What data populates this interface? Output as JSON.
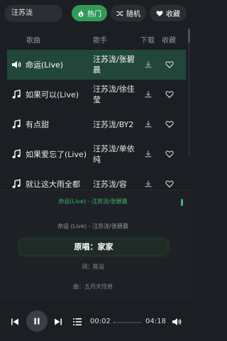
{
  "search": {
    "value": "汪苏泷"
  },
  "filters": [
    {
      "label": "热门",
      "icon": "fire-icon",
      "active": true
    },
    {
      "label": "随机",
      "icon": "shuffle-icon",
      "active": false
    },
    {
      "label": "收藏",
      "icon": "heart-icon",
      "active": false
    }
  ],
  "table": {
    "headers": {
      "song": "歌曲",
      "artist": "歌手",
      "download": "下载",
      "favorite": "收藏"
    },
    "rows": [
      {
        "title": "命运(Live)",
        "artist": "汪苏泷/张碧晨",
        "playing": true
      },
      {
        "title": "如果可以(Live)",
        "artist": "汪苏泷/徐佳莹",
        "playing": false
      },
      {
        "title": "有点甜",
        "artist": "汪苏泷/BY2",
        "playing": false
      },
      {
        "title": "如果爱忘了(Live)",
        "artist": "汪苏泷/单依纯",
        "playing": false
      },
      {
        "title": "就让这大雨全都",
        "artist": "汪苏泷/容",
        "playing": false
      }
    ]
  },
  "lyrics": {
    "now_playing": "命运(Live) - 汪苏泷/张碧晨",
    "line1": "命运 (Live) - 汪苏泷/张碧晨",
    "original_singer": "原唱：家家",
    "lyricist": "词：陈没",
    "composer": "曲：五月天怪兽"
  },
  "player": {
    "current_time": "00:02",
    "total_time": "04:18",
    "progress": 0.008
  },
  "colors": {
    "accent": "#2f9b57",
    "active_row": "#22463a",
    "background": "#1b1e22"
  }
}
